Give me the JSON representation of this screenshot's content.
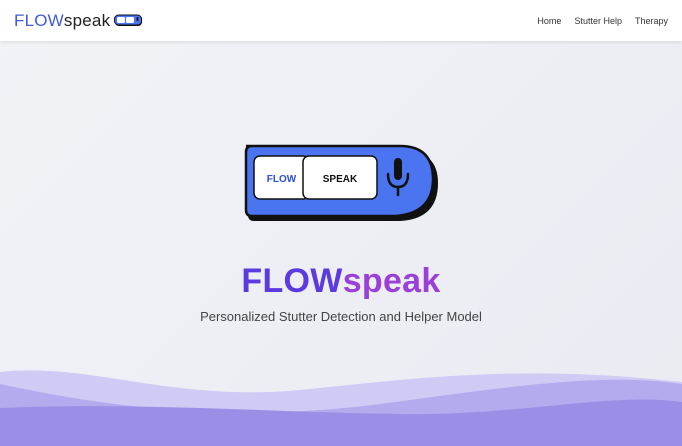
{
  "brand": {
    "flow": "FLOW",
    "speak": "speak"
  },
  "nav": {
    "items": [
      "Home",
      "Stutter Help",
      "Therapy"
    ]
  },
  "hero": {
    "logo_left": "FLOW",
    "logo_right": "SPEAK",
    "title_flow": "FLOW",
    "title_speak": "speak",
    "subtitle": "Personalized Stutter Detection and Helper Model"
  },
  "colors": {
    "brand_blue": "#3f5bd9",
    "logo_blue": "#4b74f0",
    "title_purple": "#5b3ae0",
    "title_violet": "#9a3fd8",
    "wave_light": "#c9c6f3",
    "wave_dark": "#9a8fe6"
  },
  "icons": [
    "microphone-icon"
  ]
}
